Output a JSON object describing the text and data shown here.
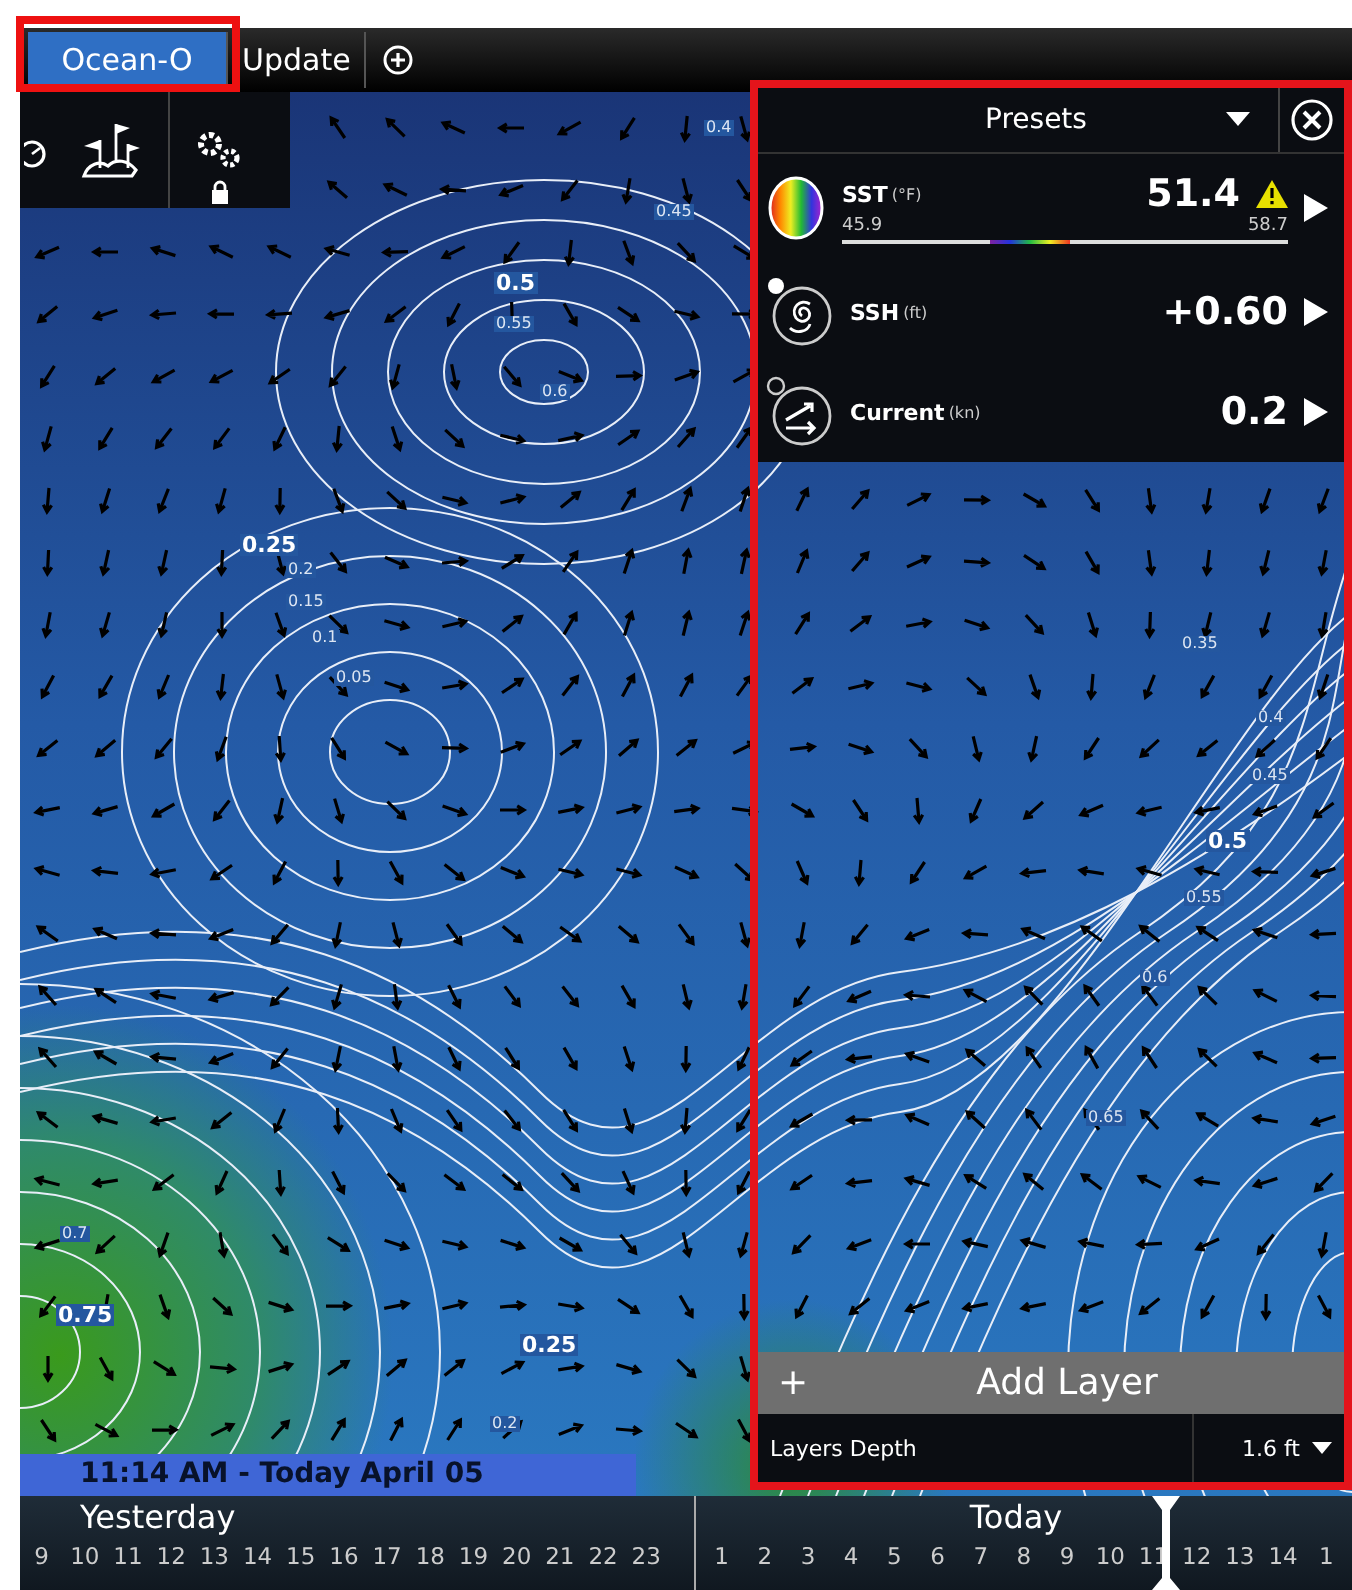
{
  "tabs": [
    {
      "label": "Ocean-O",
      "selected": true
    },
    {
      "label": "Update",
      "selected": false
    }
  ],
  "map": {
    "contour_labels": [
      {
        "text": "0.4",
        "major": false
      },
      {
        "text": "0.45",
        "major": false
      },
      {
        "text": "0.5",
        "major": true
      },
      {
        "text": "0.55",
        "major": false
      },
      {
        "text": "0.6",
        "major": false
      },
      {
        "text": "0.25",
        "major": true
      },
      {
        "text": "0.2",
        "major": false
      },
      {
        "text": "0.15",
        "major": false
      },
      {
        "text": "0.1",
        "major": false
      },
      {
        "text": "0.05",
        "major": false
      },
      {
        "text": "0.7",
        "major": false
      },
      {
        "text": "0.75",
        "major": true
      },
      {
        "text": "0.25",
        "major": true
      },
      {
        "text": "0.2",
        "major": false
      },
      {
        "text": "0.35",
        "major": false
      },
      {
        "text": "0.4",
        "major": false
      },
      {
        "text": "0.45",
        "major": false
      },
      {
        "text": "0.5",
        "major": true
      },
      {
        "text": "0.55",
        "major": false
      },
      {
        "text": "0.6",
        "major": false
      },
      {
        "text": "0.65",
        "major": false
      }
    ],
    "time_label": "11:14 AM - Today April 05"
  },
  "panel": {
    "title": "Presets",
    "layers": [
      {
        "kind": "sst",
        "name": "SST",
        "unit": "(°F)",
        "value": "51.4",
        "warning": true,
        "min": "45.9",
        "max": "58.7"
      },
      {
        "kind": "ssh",
        "name": "SSH",
        "unit": "(ft)",
        "value": "+0.60",
        "warning": false
      },
      {
        "kind": "current",
        "name": "Current",
        "unit": "(kn)",
        "value": "0.2",
        "warning": false
      }
    ],
    "add_layer": {
      "plus": "+",
      "label": "Add Layer"
    },
    "depth": {
      "label": "Layers Depth",
      "value": "1.6 ft"
    }
  },
  "timeline": {
    "days": [
      {
        "label": "Yesterday",
        "hours": [
          "9",
          "10",
          "11",
          "12",
          "13",
          "14",
          "15",
          "16",
          "17",
          "18",
          "19",
          "20",
          "21",
          "22",
          "23"
        ]
      },
      {
        "label": "Today",
        "hours": [
          "1",
          "2",
          "3",
          "4",
          "5",
          "6",
          "7",
          "8",
          "9",
          "10",
          "11",
          "12",
          "13",
          "14",
          "1"
        ]
      }
    ]
  }
}
